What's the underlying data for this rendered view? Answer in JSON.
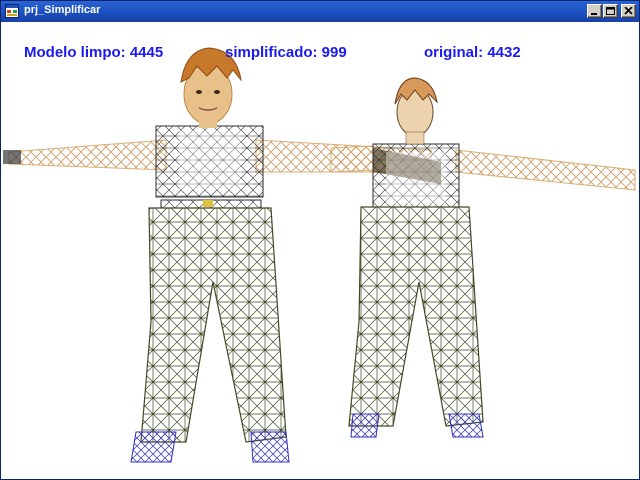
{
  "window": {
    "title": "prj_Simplificar",
    "icon": "app-form-icon",
    "controls": [
      "minimize-icon",
      "maximize-icon",
      "close-icon"
    ]
  },
  "stats": {
    "clean_model": "Modelo limpo: 4445",
    "simplified": "simplificado: 999",
    "original": "original: 4432"
  },
  "colors": {
    "title_bar": "#1c4fbf",
    "stat_text": "#1a1af0",
    "skin": "#e8c08a",
    "pants_wire": "#3f4a26",
    "shirt_wire": "#2d2d2d",
    "shoe_wire": "#3030c0",
    "hair": "#c8782a"
  }
}
